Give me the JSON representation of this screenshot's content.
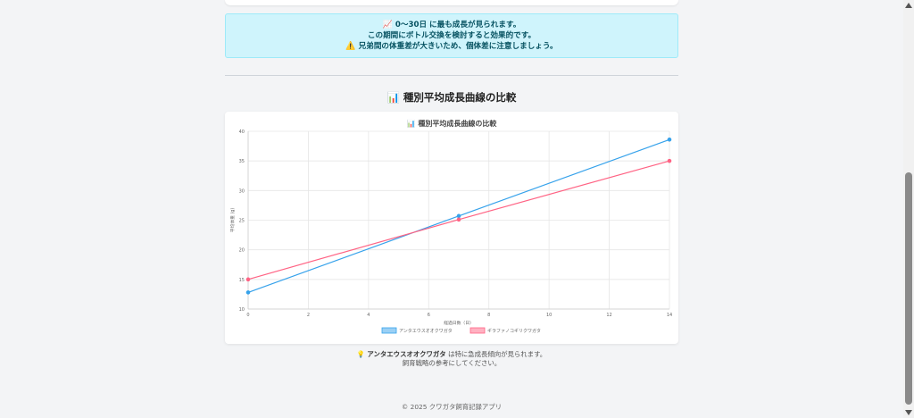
{
  "info_box": {
    "line1_icon": "📈",
    "line1": "0〜30日 に最も成長が見られます。",
    "line2": "この期間にボトル交換を検討すると効果的です。",
    "line3_icon": "⚠️",
    "line3": "兄弟間の体重差が大きいため、個体差に注意しましょう。"
  },
  "section": {
    "icon": "📊",
    "title": "種別平均成長曲線の比較"
  },
  "chart_data": {
    "type": "line",
    "title_icon": "📊",
    "title": "種別平均成長曲線の比較",
    "xlabel": "経過日数（日）",
    "ylabel": "平均体重 (g)",
    "xlim": [
      0,
      14
    ],
    "ylim": [
      10,
      40
    ],
    "xticks": [
      0,
      2,
      4,
      6,
      8,
      10,
      12,
      14
    ],
    "yticks": [
      10,
      15,
      20,
      25,
      30,
      35,
      40
    ],
    "grid": true,
    "legend_position": "bottom",
    "series": [
      {
        "name": "アンタエウスオオクワガタ",
        "color": "#36a2eb",
        "fill": "#9ad0f5",
        "points": [
          [
            0,
            12.8
          ],
          [
            7,
            25.7
          ],
          [
            14,
            38.6
          ]
        ]
      },
      {
        "name": "ギラファノコギリクワガタ",
        "color": "#ff6384",
        "fill": "#ffb1c1",
        "points": [
          [
            0,
            15.0
          ],
          [
            7,
            25.1
          ],
          [
            14,
            35.0
          ]
        ]
      }
    ]
  },
  "note": {
    "icon": "💡",
    "species": "アンタエウスオオクワガタ",
    "line1_rest": " は特に急成長傾向が見られます。",
    "line2": "飼育戦略の参考にしてください。"
  },
  "footer": {
    "text": "© 2025 クワガタ飼育記録アプリ"
  }
}
